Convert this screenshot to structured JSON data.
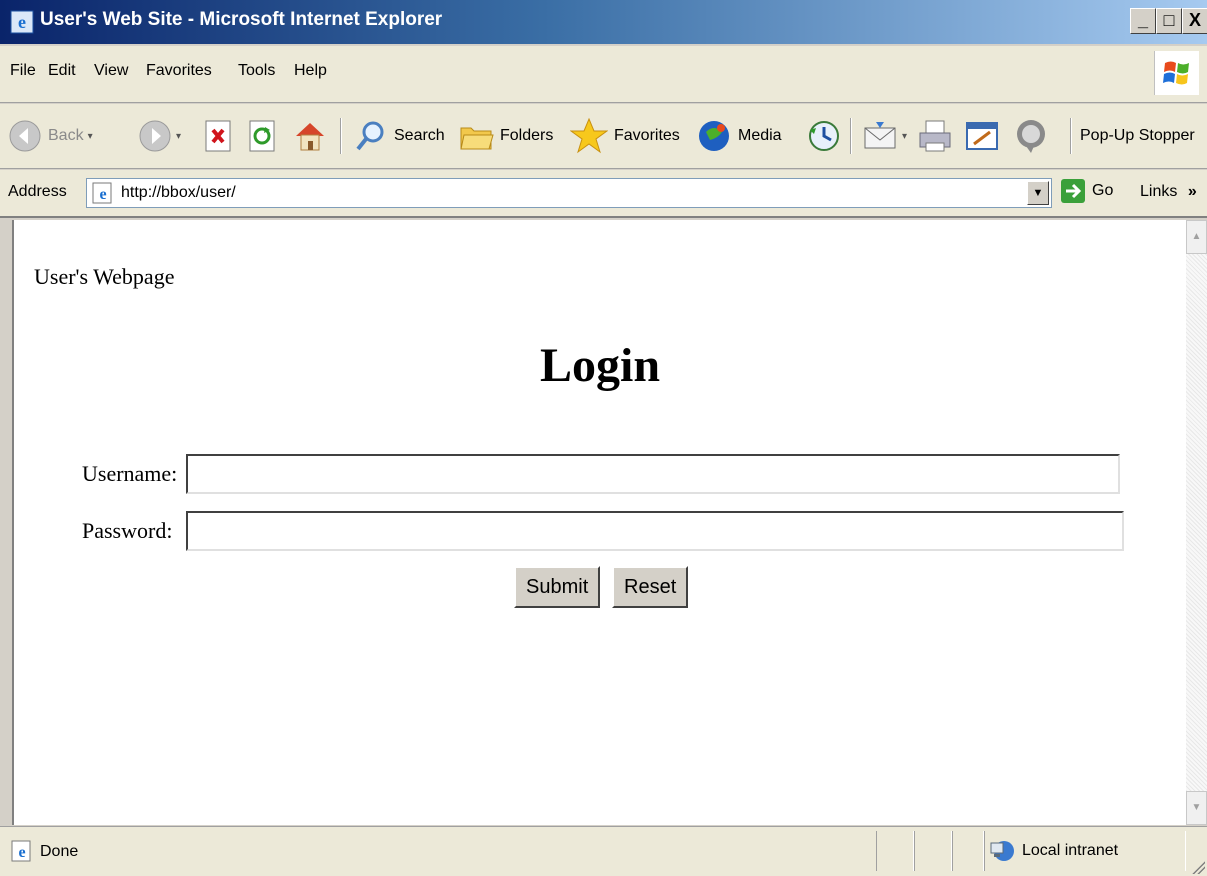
{
  "window": {
    "title": "User's Web Site - Microsoft Internet Explorer",
    "buttons": {
      "minimize": "_",
      "maximize": "□",
      "close": "X"
    }
  },
  "menu": [
    "File",
    "Edit",
    "View",
    "Favorites",
    "Tools",
    "Help"
  ],
  "toolbar": {
    "back": "Back",
    "search": "Search",
    "folders": "Folders",
    "favorites": "Favorites",
    "media": "Media",
    "popup": "Pop-Up Stopper"
  },
  "address": {
    "label": "Address",
    "url": "http://bbox/user/",
    "go": "Go",
    "links": "Links",
    "links_chevron": "»"
  },
  "page": {
    "site_title": "User's Webpage",
    "heading": "Login",
    "username_label": "Username:",
    "password_label": "Password:",
    "username_value": "",
    "password_value": "",
    "submit": "Submit",
    "reset": "Reset"
  },
  "status": {
    "text": "Done",
    "zone": "Local intranet"
  },
  "icons": {
    "app": "ie-icon",
    "back": "back-arrow-icon",
    "forward": "forward-arrow-icon",
    "stop": "stop-icon",
    "refresh": "refresh-icon",
    "home": "home-icon",
    "search": "search-icon",
    "folders": "folders-icon",
    "favorites": "star-icon",
    "media": "media-icon",
    "history": "history-icon",
    "mail": "mail-icon",
    "print": "print-icon",
    "edit": "edit-icon",
    "messenger": "messenger-icon",
    "go": "go-arrow-icon",
    "zone": "local-intranet-icon"
  }
}
